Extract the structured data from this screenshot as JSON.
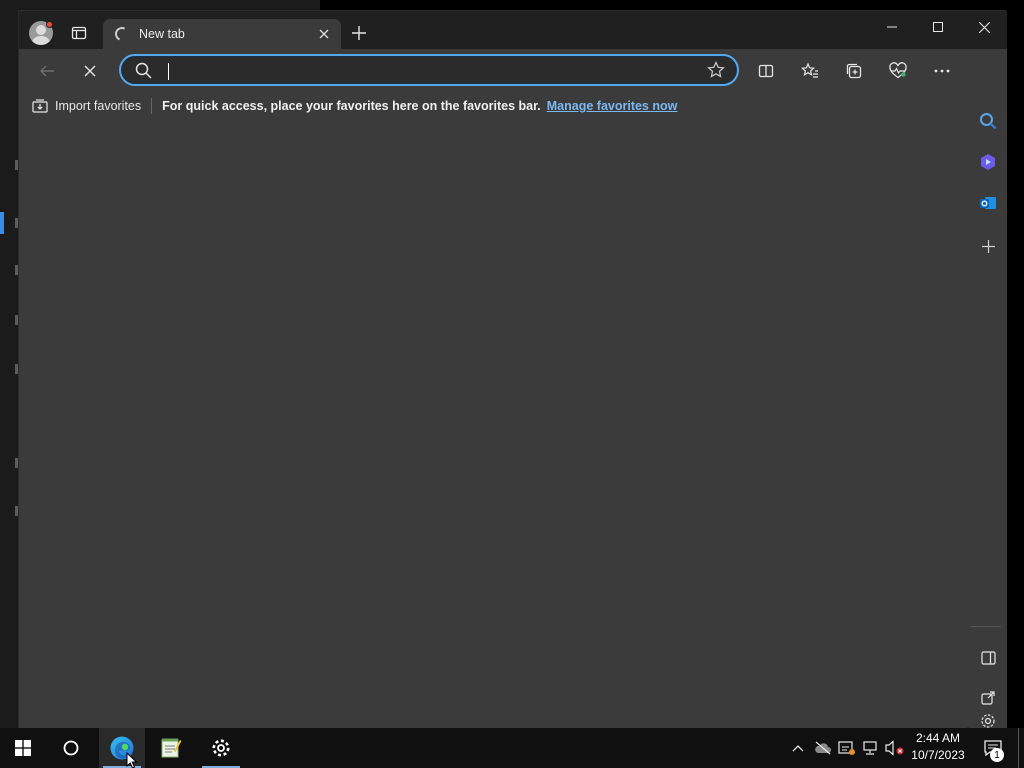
{
  "browser": {
    "tab": {
      "title": "New tab"
    },
    "address_bar": {
      "value": "",
      "placeholder": ""
    },
    "favorites_bar": {
      "import_label": "Import favorites",
      "message": "For quick access, place your favorites here on the favorites bar.",
      "link_label": "Manage favorites now"
    },
    "accent_color": "#5aa7e8"
  },
  "taskbar": {
    "time": "2:44 AM",
    "date": "10/7/2023",
    "notification_count": "1",
    "apps": [
      "start-icon",
      "cortana-icon",
      "edge-icon",
      "notepad-icon",
      "settings-icon"
    ]
  }
}
